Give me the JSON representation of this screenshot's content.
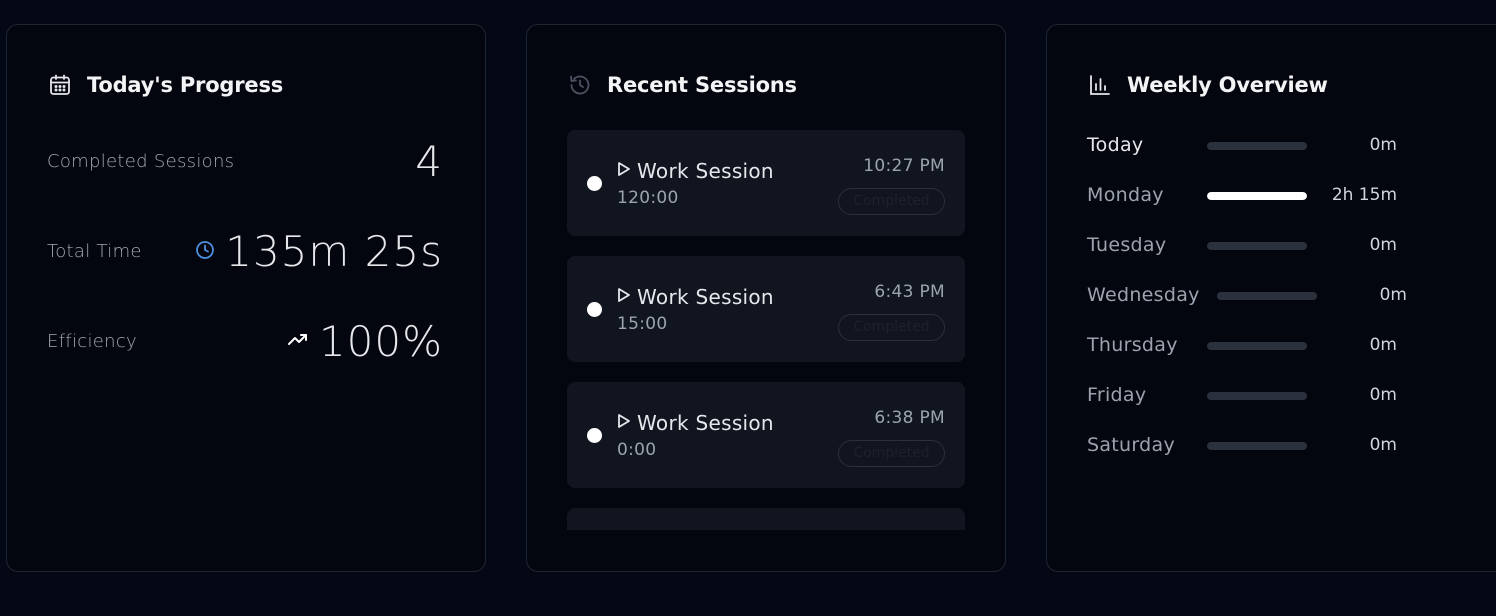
{
  "progress": {
    "title": "Today's Progress",
    "icon": "calendar-icon",
    "completed_label": "Completed Sessions",
    "completed_value": "4",
    "total_time_label": "Total Time",
    "total_time_value": "135m 25s",
    "efficiency_label": "Efficiency",
    "efficiency_value": "100%"
  },
  "sessions": {
    "title": "Recent Sessions",
    "icon": "history-icon",
    "items": [
      {
        "name": "Work Session",
        "duration": "120:00",
        "time": "10:27 PM",
        "status": "Completed"
      },
      {
        "name": "Work Session",
        "duration": "15:00",
        "time": "6:43 PM",
        "status": "Completed"
      },
      {
        "name": "Work Session",
        "duration": "0:00",
        "time": "6:38 PM",
        "status": "Completed"
      }
    ]
  },
  "weekly": {
    "title": "Weekly Overview",
    "icon": "bar-chart-icon",
    "days": [
      {
        "day": "Today",
        "value": "0m",
        "fill": 0
      },
      {
        "day": "Monday",
        "value": "2h 15m",
        "fill": 1
      },
      {
        "day": "Tuesday",
        "value": "0m",
        "fill": 0
      },
      {
        "day": "Wednesday",
        "value": "0m",
        "fill": 0
      },
      {
        "day": "Thursday",
        "value": "0m",
        "fill": 0
      },
      {
        "day": "Friday",
        "value": "0m",
        "fill": 0
      },
      {
        "day": "Saturday",
        "value": "0m",
        "fill": 0
      }
    ]
  },
  "colors": {
    "accent_blue": "#4d8fe0",
    "bar_track": "#2a303c",
    "bar_fill": "#ffffff"
  }
}
